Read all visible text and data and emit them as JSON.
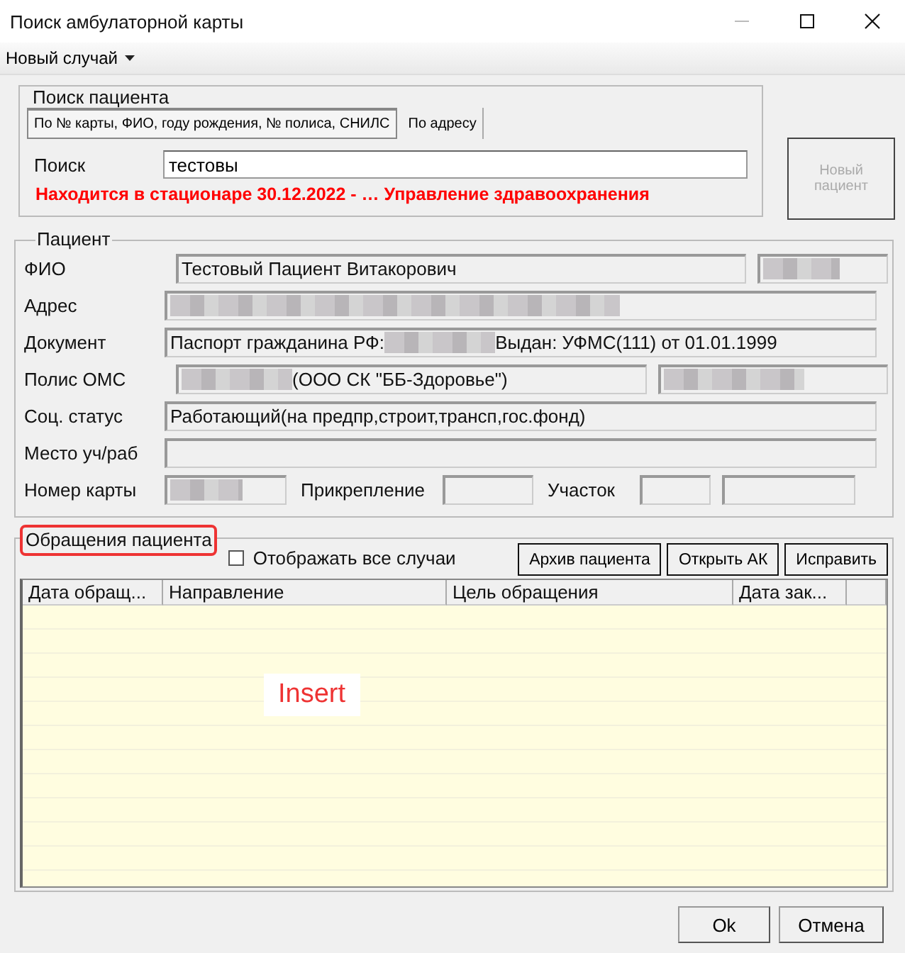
{
  "window": {
    "title": "Поиск амбулаторной карты"
  },
  "menu": [
    {
      "label": "Новый случай",
      "dropdown": true
    }
  ],
  "search": {
    "title": "Поиск пациента",
    "tabs": [
      {
        "label": "По № карты, ФИО, году рождения, № полиса, СНИЛС",
        "selected": true
      },
      {
        "label": "По адресу",
        "selected": false
      }
    ],
    "label": "Поиск",
    "value": "тестовы",
    "warning": "Находится в стационаре 30.12.2022 -  … Управление здравоохранения"
  },
  "new_patient_button": {
    "label": "Новый пациент",
    "disabled": true
  },
  "patient": {
    "title": "Пациент",
    "rows": [
      {
        "kind": "pair",
        "items": [
          {
            "kind": "label",
            "text": "ФИО"
          },
          {
            "kind": "field",
            "parts": [
              {
                "kind": "text",
                "text": "Тестовый Пациент Витакорович"
              }
            ]
          },
          {
            "kind": "field",
            "parts": [
              {
                "kind": "redacted"
              }
            ]
          }
        ]
      },
      {
        "kind": "full",
        "items": [
          {
            "kind": "label",
            "text": "Адрес"
          },
          {
            "kind": "field",
            "parts": [
              {
                "kind": "redacted"
              }
            ]
          }
        ]
      },
      {
        "kind": "full",
        "items": [
          {
            "kind": "label",
            "text": "Документ"
          },
          {
            "kind": "field",
            "parts": [
              {
                "kind": "text",
                "text": "Паспорт гражданина РФ:"
              },
              {
                "kind": "redacted"
              },
              {
                "kind": "text",
                "text": "Выдан: УФМС(111) от 01.01.1999"
              }
            ]
          }
        ]
      },
      {
        "kind": "policy",
        "items": [
          {
            "kind": "label",
            "text": "Полис ОМС"
          },
          {
            "kind": "field",
            "parts": [
              {
                "kind": "redacted"
              },
              {
                "kind": "text",
                "text": "(ООО СК \"ББ-Здоровье\")"
              }
            ]
          },
          {
            "kind": "field",
            "parts": [
              {
                "kind": "redacted"
              }
            ]
          }
        ]
      },
      {
        "kind": "full",
        "items": [
          {
            "kind": "label",
            "text": "Соц. статус"
          },
          {
            "kind": "field",
            "parts": [
              {
                "kind": "text",
                "text": "Работающий(на предпр,строит,трансп,гос.фонд)"
              }
            ]
          }
        ]
      },
      {
        "kind": "full",
        "items": [
          {
            "kind": "label",
            "text": "Место уч/раб"
          },
          {
            "kind": "field"
          }
        ]
      },
      {
        "kind": "card",
        "items": [
          {
            "kind": "label",
            "text": "Номер карты"
          },
          {
            "kind": "field",
            "parts": [
              {
                "kind": "redacted"
              }
            ]
          },
          {
            "kind": "label",
            "text": "Прикрепление"
          },
          {
            "kind": "field"
          },
          {
            "kind": "label",
            "text": "Участок"
          },
          {
            "kind": "field"
          },
          {
            "kind": "field"
          }
        ]
      }
    ]
  },
  "appeals": {
    "title": "Обращения пациента",
    "title_highlighted": true,
    "show_all": {
      "label": "Отображать все случаи",
      "checked": false
    },
    "buttons": [
      "Архив пациента",
      "Открыть АК",
      "Исправить"
    ],
    "columns": [
      "Дата обращ...",
      "Направление",
      "Цель обращения",
      "Дата зак..."
    ],
    "annotation": "Insert"
  },
  "footer_buttons": [
    "Ok",
    "Отмена"
  ]
}
